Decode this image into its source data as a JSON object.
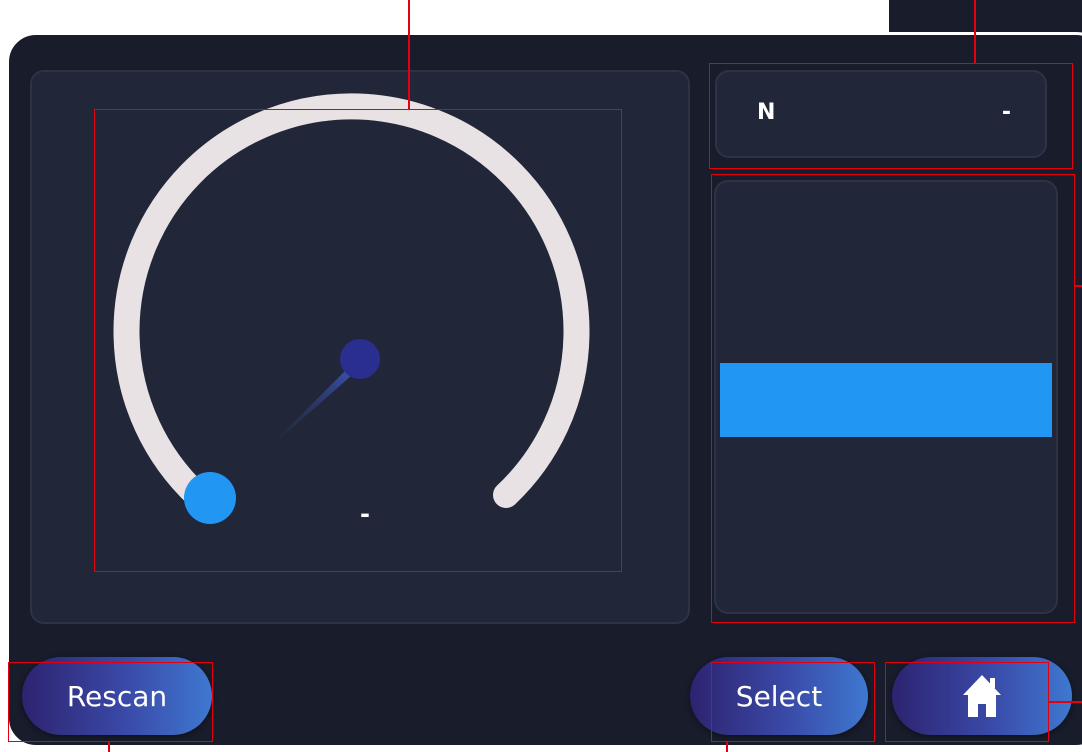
{
  "gauge": {
    "value_text": "-",
    "level": 0
  },
  "info": {
    "label": "N",
    "value": "-"
  },
  "level_bar": {
    "level": 0.5
  },
  "buttons": {
    "rescan": "Rescan",
    "select": "Select",
    "home_icon": "home-icon"
  },
  "colors": {
    "background": "#181c2b",
    "panel": "#212739",
    "accent": "#2196f3",
    "arc": "#e8e2e4",
    "highlight": "#e3000f"
  }
}
